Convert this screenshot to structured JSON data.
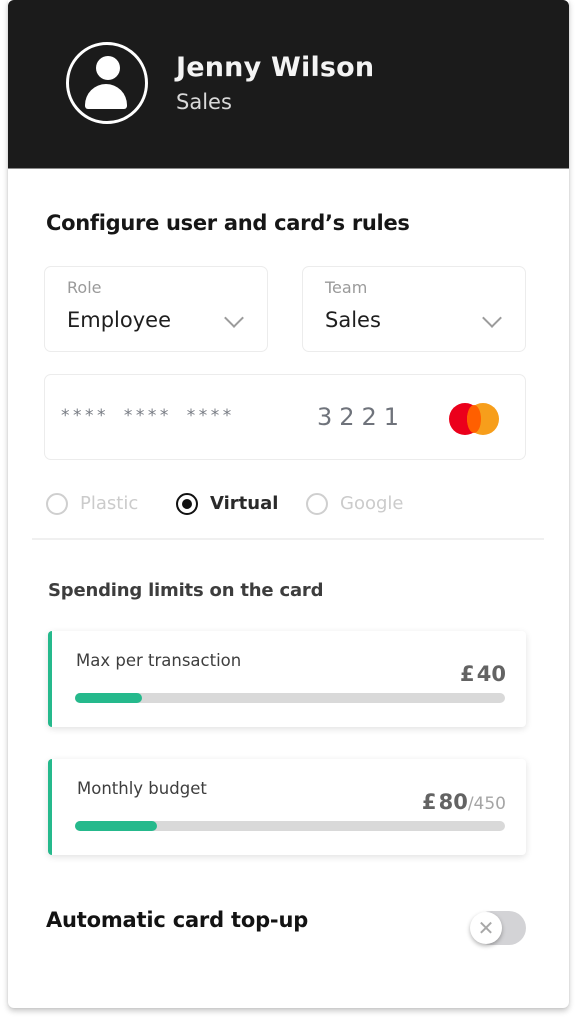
{
  "user": {
    "name": "Jenny Wilson",
    "team": "Sales",
    "avatar_icon": "user-avatar-icon"
  },
  "config": {
    "title": "Configure user and card’s rules",
    "role": {
      "label": "Role",
      "value": "Employee",
      "icon": "chevron-down-icon"
    },
    "team": {
      "label": "Team",
      "value": "Sales",
      "icon": "chevron-down-icon"
    }
  },
  "card": {
    "masked": "**** **** ****",
    "last4": "3221",
    "brand": "Mastercard",
    "brand_colors": {
      "red": "#eb001b",
      "orange": "#f79e1b",
      "overlap": "#ff5f00"
    }
  },
  "card_types": [
    {
      "label": "Plastic",
      "selected": false
    },
    {
      "label": "Virtual",
      "selected": true
    },
    {
      "label": "Google",
      "selected": false
    }
  ],
  "limits": {
    "title": "Spending limits on the card",
    "items": [
      {
        "label": "Max per transaction",
        "currency": "£",
        "amount": "40",
        "total": "",
        "progress_percent": 15.5
      },
      {
        "label": "Monthly budget",
        "currency": "£",
        "amount": "80",
        "total": "/450",
        "progress_percent": 19
      }
    ]
  },
  "topup": {
    "label": "Automatic card top-up",
    "enabled": false,
    "toggle_icon": "✕"
  },
  "colors": {
    "header_bg": "#1b1b1b",
    "accent": "#25b98c",
    "track": "#d9d9d9"
  }
}
